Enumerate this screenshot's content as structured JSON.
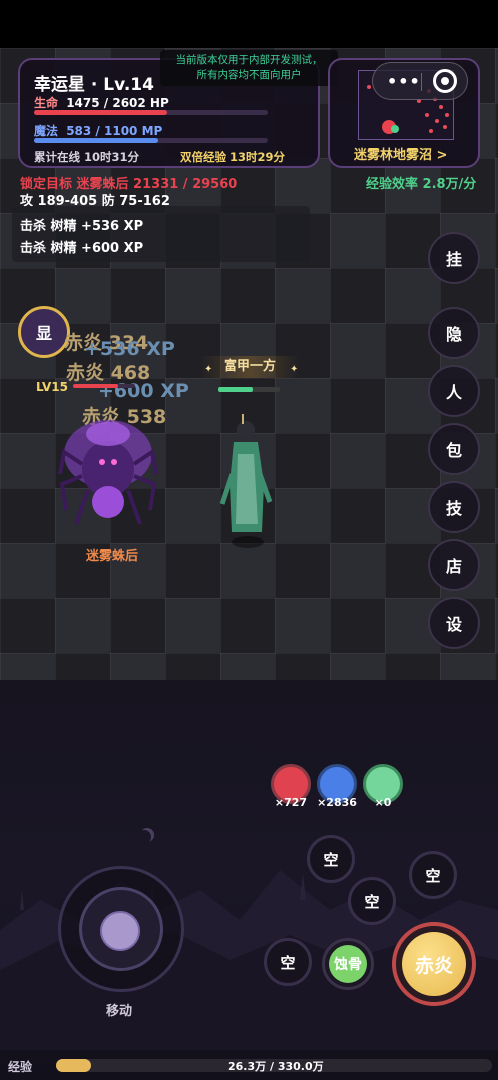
{
  "player": {
    "name": "幸运星 · Lv.14",
    "hp_label": "生命",
    "hp_value": "1475 / 2602 HP",
    "hp_fraction": 0.567,
    "mp_label": "魔法",
    "mp_value": "583 / 1100 MP",
    "mp_fraction": 0.53,
    "online_time": "累计在线 10时31分",
    "double_xp": "双倍经验 13时29分"
  },
  "notice": {
    "line1": "当前版本仅用于内部开发测试，",
    "line2": "所有内容均不面向用户"
  },
  "minimap": {
    "location": "迷雾林地雾沼 >"
  },
  "target": {
    "text": "锁定目标  迷雾蛛后  21331 / 29560",
    "attack_defense": "攻 189-405   防 75-162"
  },
  "xp_rate": "经验效率 2.8万/分",
  "kill_log": [
    "击杀 树精  +536 XP",
    "击杀 树精  +600 XP"
  ],
  "side_buttons": [
    "挂",
    "隐",
    "人",
    "包",
    "技",
    "店",
    "设"
  ],
  "show_button": "显",
  "enemy": {
    "level": "LV15",
    "name": "迷雾蛛后",
    "hp_fraction": 0.72
  },
  "floating_text": [
    {
      "text": "赤炎 334",
      "color": "#b8a070"
    },
    {
      "text": "+536 XP",
      "color": "#6b8fb0"
    },
    {
      "text": "赤炎 468",
      "color": "#b8a070"
    },
    {
      "text": "+600 XP",
      "color": "#6b8fb0"
    },
    {
      "text": "赤炎 538",
      "color": "#b8a070"
    }
  ],
  "player_title": "富甲一方",
  "potions": [
    {
      "count": "×727",
      "color": "#e0434f"
    },
    {
      "count": "×2836",
      "color": "#4a7fe8"
    },
    {
      "count": "×0",
      "color": "#74d69a"
    }
  ],
  "skills": {
    "empty_label": "空",
    "erode_bone": "蚀骨",
    "main_skill": "赤炎"
  },
  "joystick_label": "移动",
  "experience": {
    "label": "经验",
    "value": "26.3万 / 330.0万",
    "fraction": 0.08
  },
  "colors": {
    "hp": "#e8434f",
    "mp": "#5a8dee",
    "accent_gold": "#e6b95c",
    "target_red": "#e8434f",
    "xp_green": "#4fd18b"
  }
}
